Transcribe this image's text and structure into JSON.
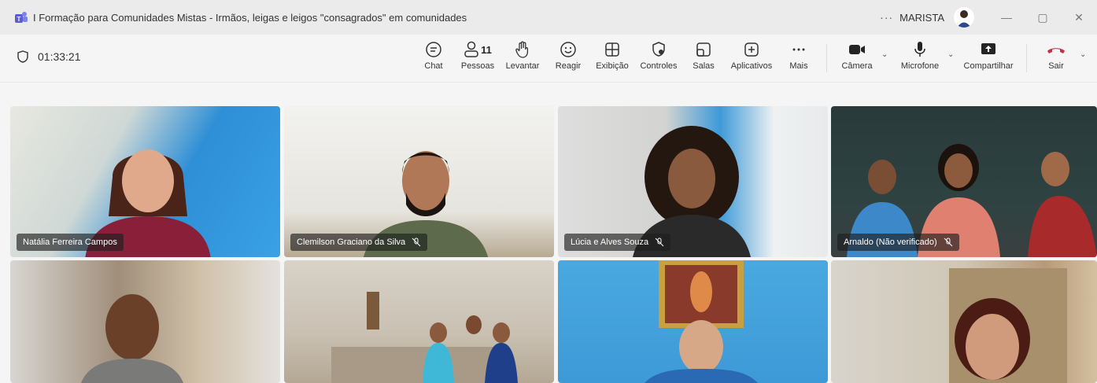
{
  "window": {
    "title": "I Formação para Comunidades Mistas - Irmãos, leigas e leigos \"consagrados\" em comunidades",
    "more_label": "···",
    "org_label": "MARISTA",
    "minimize_label": "—",
    "restore_label": "▢",
    "close_label": "✕"
  },
  "toolbar": {
    "timer": "01:33:21",
    "people_count": "11",
    "buttons": {
      "chat": "Chat",
      "people": "Pessoas",
      "raise": "Levantar",
      "react": "Reagir",
      "view": "Exibição",
      "controls": "Controles",
      "rooms": "Salas",
      "apps": "Aplicativos",
      "more": "Mais",
      "camera": "Câmera",
      "mic": "Microfone",
      "share": "Compartilhar",
      "leave": "Sair"
    }
  },
  "participants": [
    {
      "name": "Natália Ferreira Campos",
      "muted": false
    },
    {
      "name": "Clemilson Graciano da Silva",
      "muted": true
    },
    {
      "name": "Lúcia e Alves Souza",
      "muted": true
    },
    {
      "name": "Arnaldo (Não verificado)",
      "muted": true
    },
    {
      "name": "",
      "muted": false
    },
    {
      "name": "",
      "muted": false
    },
    {
      "name": "",
      "muted": false
    },
    {
      "name": "",
      "muted": false
    }
  ],
  "colors": {
    "leave_red": "#c4314b",
    "accent": "#5b5fc7"
  }
}
